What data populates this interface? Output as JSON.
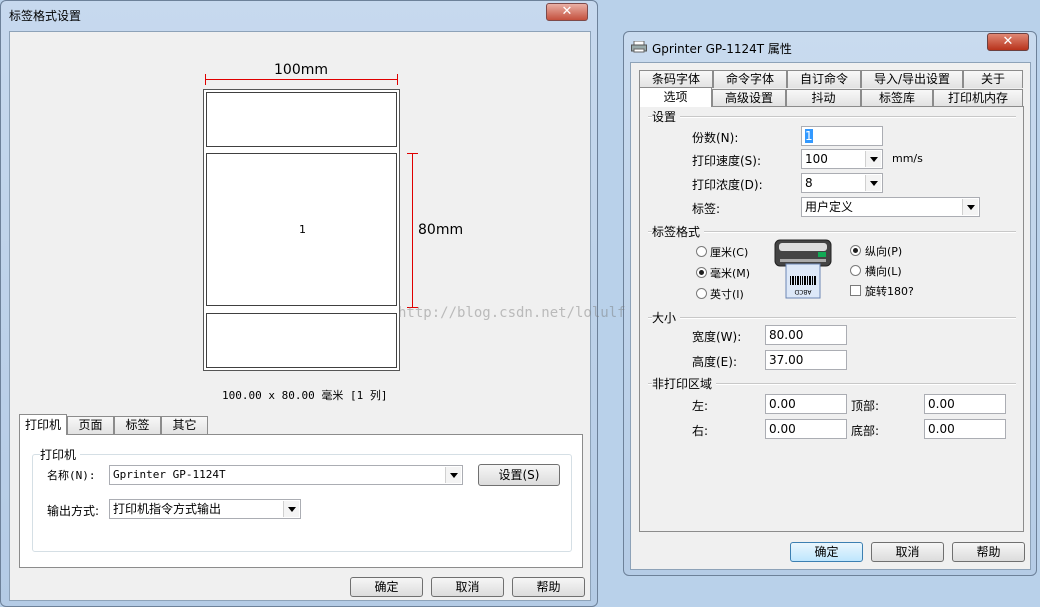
{
  "left_window": {
    "title": "标签格式设置",
    "close": "✕",
    "preview": {
      "width_dim": "100mm",
      "height_dim": "80mm",
      "label_number": "1",
      "caption": "100.00 x 80.00 毫米 [1 列]"
    },
    "tabs": [
      "打印机",
      "页面",
      "标签",
      "其它"
    ],
    "printer_group": "打印机",
    "name_label": "名称(N):",
    "name_value": "Gprinter  GP-1124T",
    "settings_button": "设置(S)",
    "output_label": "输出方式:",
    "output_value": "打印机指令方式输出",
    "ok": "确定",
    "cancel": "取消",
    "help": "帮助"
  },
  "watermark": "http://blog.csdn.net/lolulf",
  "right_window": {
    "title": "Gprinter  GP-1124T 属性",
    "close": "✕",
    "tabs_row1": [
      "条码字体",
      "命令字体",
      "自订命令",
      "导入/导出设置",
      "关于"
    ],
    "tabs_row2": [
      "选项",
      "高级设置",
      "抖动",
      "标签库",
      "打印机内存"
    ],
    "settings_group": "设置",
    "copies_label": "份数(N):",
    "copies_value": "1",
    "speed_label": "打印速度(S):",
    "speed_value": "100",
    "speed_unit": "mm/s",
    "density_label": "打印浓度(D):",
    "density_value": "8",
    "label_label": "标签:",
    "label_value": "用户定义",
    "format_group": "标签格式",
    "unit_cm": "厘米(C)",
    "unit_mm": "毫米(M)",
    "unit_inch": "英寸(I)",
    "portrait": "纵向(P)",
    "landscape": "横向(L)",
    "rotate": "旋转180?",
    "icon_text": "ABCD",
    "size_group": "大小",
    "width_label": "宽度(W):",
    "width_value": "80.00",
    "height_label": "高度(E):",
    "height_value": "37.00",
    "nonprint_group": "非打印区域",
    "left_label": "左:",
    "left_value": "0.00",
    "top_label": "顶部:",
    "top_value": "0.00",
    "right_label": "右:",
    "right_value": "0.00",
    "bottom_label": "底部:",
    "bottom_value": "0.00",
    "ok": "确定",
    "cancel": "取消",
    "help": "帮助"
  }
}
